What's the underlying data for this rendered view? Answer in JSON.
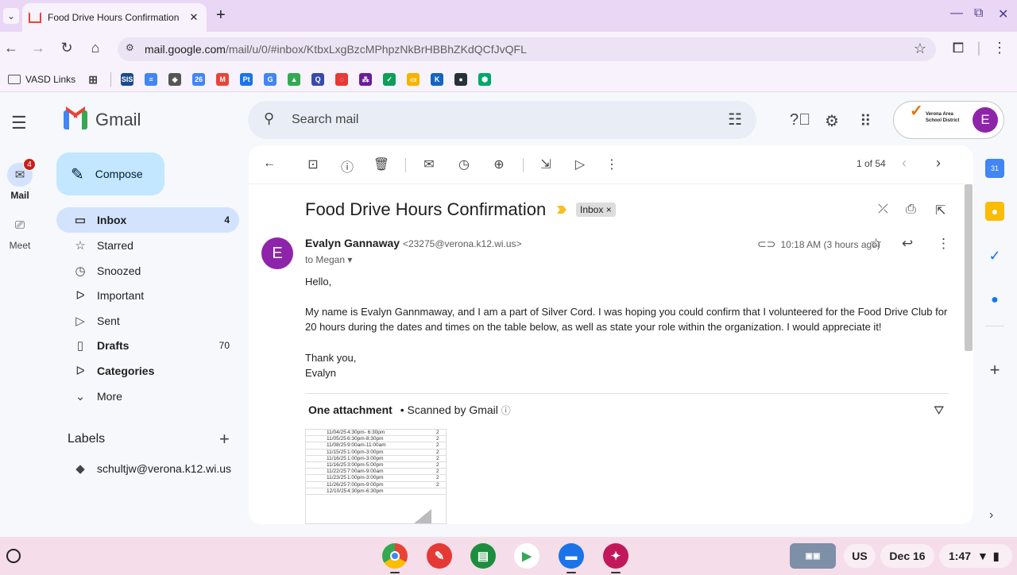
{
  "browser": {
    "tab_title": "Food Drive Hours Confirmation",
    "url_host": "mail.google.com",
    "url_path": "/mail/u/0/#inbox/KtbxLxgBzcMPhpzNkBrHBBhZKdQCfJvQFL",
    "bookmark_folder": "VASD Links",
    "bookmark_icons": [
      {
        "name": "sis",
        "text": "SIS",
        "color": "#1a4b8c"
      },
      {
        "name": "docs",
        "text": "≡",
        "color": "#4285f4"
      },
      {
        "name": "shield",
        "text": "◈",
        "color": "#555555"
      },
      {
        "name": "calendar",
        "text": "26",
        "color": "#4285f4"
      },
      {
        "name": "gmail",
        "text": "M",
        "color": "#ea4335"
      },
      {
        "name": "pt",
        "text": "Pt",
        "color": "#1a73e8"
      },
      {
        "name": "google",
        "text": "G",
        "color": "#4285f4"
      },
      {
        "name": "drive",
        "text": "▲",
        "color": "#34a853"
      },
      {
        "name": "q",
        "text": "Q",
        "color": "#3949ab"
      },
      {
        "name": "ring",
        "text": "◌",
        "color": "#e53935"
      },
      {
        "name": "dots",
        "text": "⁂",
        "color": "#6a1b9a"
      },
      {
        "name": "check",
        "text": "✓",
        "color": "#0f9d58"
      },
      {
        "name": "slides",
        "text": "▭",
        "color": "#f4b400"
      },
      {
        "name": "k",
        "text": "K",
        "color": "#1565c0"
      },
      {
        "name": "edm",
        "text": "●",
        "color": "#263238"
      },
      {
        "name": "green-hex",
        "text": "⬢",
        "color": "#00a86b"
      }
    ]
  },
  "gmail": {
    "brand": "Gmail",
    "search_placeholder": "Search mail",
    "account_org_line1": "Verona Area",
    "account_org_line2": "School District",
    "avatar_letter": "E",
    "rail": {
      "mail_label": "Mail",
      "mail_badge": "4",
      "meet_label": "Meet"
    },
    "compose_label": "Compose",
    "nav": [
      {
        "label": "Inbox",
        "count": "4",
        "icon": "▭"
      },
      {
        "label": "Starred",
        "count": "",
        "icon": "☆"
      },
      {
        "label": "Snoozed",
        "count": "",
        "icon": "◷"
      },
      {
        "label": "Important",
        "count": "",
        "icon": "ᐅ"
      },
      {
        "label": "Sent",
        "count": "",
        "icon": "▷"
      },
      {
        "label": "Drafts",
        "count": "70",
        "icon": "▯"
      },
      {
        "label": "Categories",
        "count": "",
        "icon": "ᐅ"
      },
      {
        "label": "More",
        "count": "",
        "icon": "⌄"
      }
    ],
    "labels_heading": "Labels",
    "labels": [
      {
        "label": "schultjw@verona.k12.wi.us"
      }
    ]
  },
  "message": {
    "pager": "1 of 54",
    "subject": "Food Drive Hours Confirmation",
    "inbox_chip": "Inbox ×",
    "sender_initial": "E",
    "sender_name": "Evalyn Gannaway",
    "sender_addr": "<23275@verona.k12.wi.us>",
    "to_line": "to Megan",
    "time": "10:18 AM (3 hours ago)",
    "greeting": "Hello,",
    "paragraph1": "My name is Evalyn Gannmaway, and I am a part of Silver Cord. I was hoping you could confirm that I volunteered for the Food Drive Club for",
    "paragraph2": "20 hours during the dates and times on the table below, as well as state your role within the organization. I would appreciate it!",
    "signoff1": "Thank you,",
    "signoff2": "Evalyn",
    "attachment_title": "One attachment",
    "attachment_scan": "Scanned by Gmail",
    "attachment_rows": [
      {
        "date": "11/04/25",
        "time": "4:30pm- 6:30pm",
        "hours": "2"
      },
      {
        "date": "11/05/25",
        "time": "6:30pm-8:30pm",
        "hours": "2"
      },
      {
        "date": "11/08/25",
        "time": "9:00am-11:00am",
        "hours": "2"
      },
      {
        "date": "11/15/25",
        "time": "1:00pm-3:00pm",
        "hours": "2"
      },
      {
        "date": "11/16/25",
        "time": "1:00pm-3:00pm",
        "hours": "2"
      },
      {
        "date": "11/16/25",
        "time": "3:00pm-5:00pm",
        "hours": "2"
      },
      {
        "date": "11/22/25",
        "time": "7:00am-9:00am",
        "hours": "2"
      },
      {
        "date": "11/23/25",
        "time": "1:00pm-3:00pm",
        "hours": "2"
      },
      {
        "date": "11/26/25",
        "time": "7:00pm-9:00pm",
        "hours": "2"
      },
      {
        "date": "12/10/25",
        "time": "4:30pm-6:30pm",
        "hours": ""
      }
    ]
  },
  "shelf": {
    "input_method": "US",
    "date": "Dec 16",
    "clock": "1:47"
  },
  "colors": {
    "tabstrip": "#e9d7f5",
    "accent": "#d3e3fd",
    "compose": "#c2e7ff",
    "avatar": "#8e24aa"
  }
}
